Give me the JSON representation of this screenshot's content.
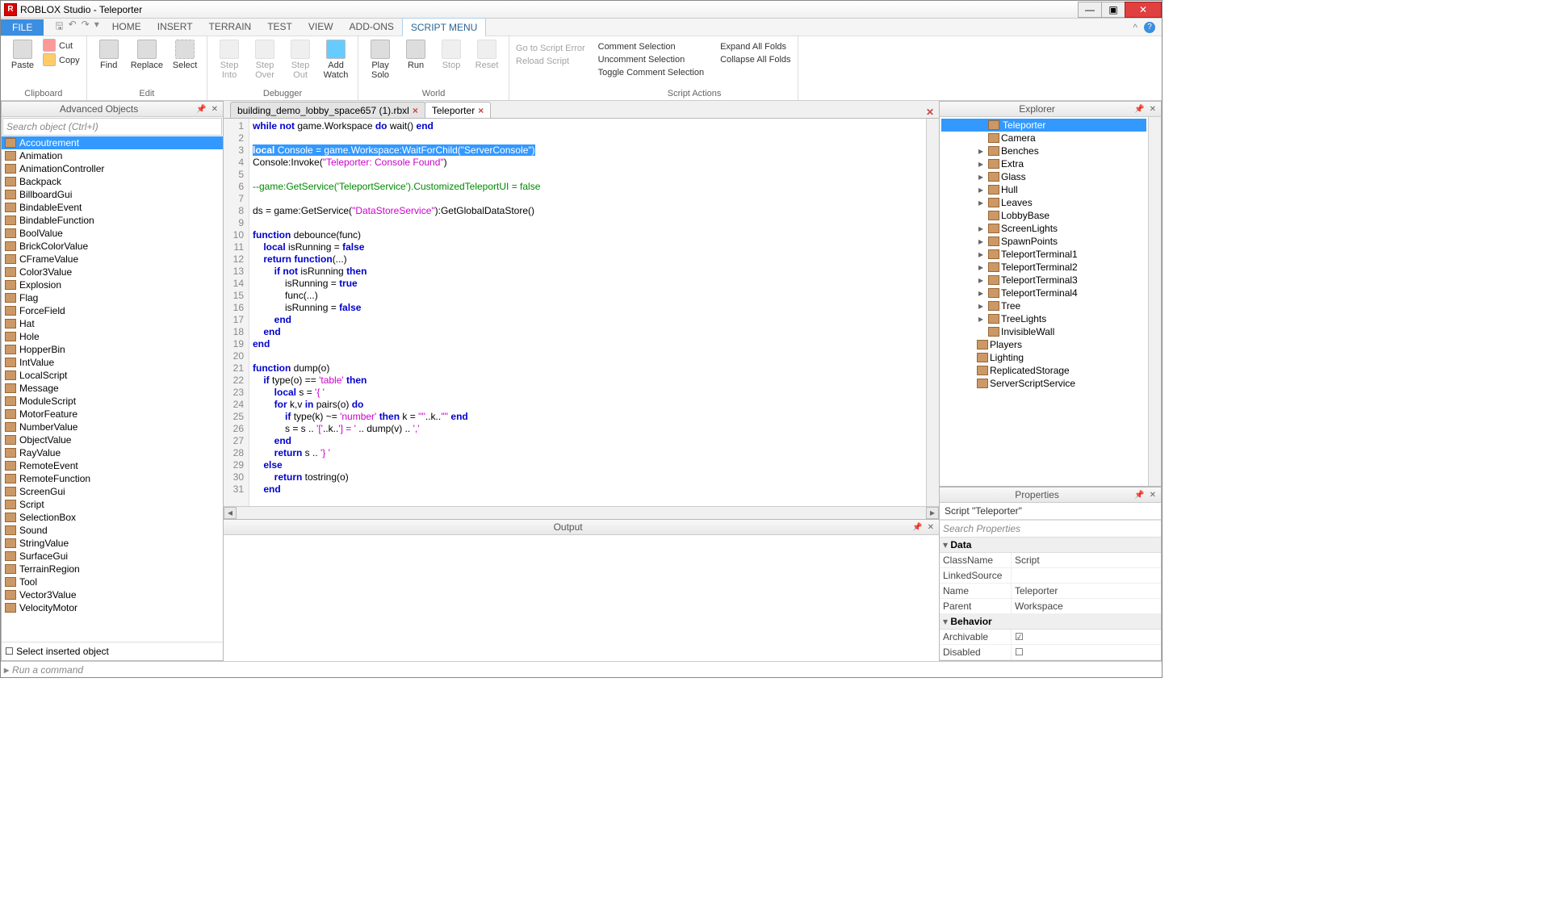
{
  "title": "ROBLOX Studio - Teleporter",
  "menu": {
    "file": "FILE",
    "tabs": [
      "HOME",
      "INSERT",
      "TERRAIN",
      "TEST",
      "VIEW",
      "ADD-ONS",
      "SCRIPT MENU"
    ],
    "activeTab": "SCRIPT MENU"
  },
  "ribbon": {
    "clipboard": {
      "paste": "Paste",
      "cut": "Cut",
      "copy": "Copy",
      "label": "Clipboard"
    },
    "edit": {
      "find": "Find",
      "replace": "Replace",
      "select": "Select",
      "label": "Edit"
    },
    "debugger": {
      "into": "Step\nInto",
      "over": "Step\nOver",
      "out": "Step\nOut",
      "watch": "Add\nWatch",
      "label": "Debugger"
    },
    "world": {
      "solo": "Play\nSolo",
      "run": "Run",
      "stop": "Stop",
      "reset": "Reset",
      "label": "World"
    },
    "scriptnav": {
      "goerr": "Go to Script Error",
      "reload": "Reload Script"
    },
    "scriptactions": {
      "c1": "Comment Selection",
      "c2": "Uncomment Selection",
      "c3": "Toggle Comment Selection",
      "c4": "Expand All Folds",
      "c5": "Collapse All Folds",
      "label": "Script Actions"
    }
  },
  "leftPanel": {
    "title": "Advanced Objects",
    "search": "Search object (Ctrl+I)",
    "items": [
      "Accoutrement",
      "Animation",
      "AnimationController",
      "Backpack",
      "BillboardGui",
      "BindableEvent",
      "BindableFunction",
      "BoolValue",
      "BrickColorValue",
      "CFrameValue",
      "Color3Value",
      "Explosion",
      "Flag",
      "ForceField",
      "Hat",
      "Hole",
      "HopperBin",
      "IntValue",
      "LocalScript",
      "Message",
      "ModuleScript",
      "MotorFeature",
      "NumberValue",
      "ObjectValue",
      "RayValue",
      "RemoteEvent",
      "RemoteFunction",
      "ScreenGui",
      "Script",
      "SelectionBox",
      "Sound",
      "StringValue",
      "SurfaceGui",
      "TerrainRegion",
      "Tool",
      "Vector3Value",
      "VelocityMotor"
    ],
    "selected": "Accoutrement",
    "checkbox": "Select inserted object"
  },
  "fileTabs": {
    "tabs": [
      "building_demo_lobby_space657 (1).rbxl",
      "Teleporter"
    ],
    "active": "Teleporter"
  },
  "explorer": {
    "title": "Explorer",
    "nodes": [
      {
        "d": 3,
        "label": "Teleporter",
        "sel": true,
        "icn": "script"
      },
      {
        "d": 3,
        "label": "Camera",
        "icn": "camera"
      },
      {
        "d": 3,
        "label": "Benches",
        "exp": "▸",
        "icn": "model"
      },
      {
        "d": 3,
        "label": "Extra",
        "exp": "▸",
        "icn": "model"
      },
      {
        "d": 3,
        "label": "Glass",
        "exp": "▸",
        "icn": "model"
      },
      {
        "d": 3,
        "label": "Hull",
        "exp": "▸",
        "icn": "model"
      },
      {
        "d": 3,
        "label": "Leaves",
        "exp": "▸",
        "icn": "model"
      },
      {
        "d": 3,
        "label": "LobbyBase",
        "icn": "model"
      },
      {
        "d": 3,
        "label": "ScreenLights",
        "exp": "▸",
        "icn": "model"
      },
      {
        "d": 3,
        "label": "SpawnPoints",
        "exp": "▸",
        "icn": "model"
      },
      {
        "d": 3,
        "label": "TeleportTerminal1",
        "exp": "▸",
        "icn": "model"
      },
      {
        "d": 3,
        "label": "TeleportTerminal2",
        "exp": "▸",
        "icn": "model"
      },
      {
        "d": 3,
        "label": "TeleportTerminal3",
        "exp": "▸",
        "icn": "model"
      },
      {
        "d": 3,
        "label": "TeleportTerminal4",
        "exp": "▸",
        "icn": "model"
      },
      {
        "d": 3,
        "label": "Tree",
        "exp": "▸",
        "icn": "model"
      },
      {
        "d": 3,
        "label": "TreeLights",
        "exp": "▸",
        "icn": "model"
      },
      {
        "d": 3,
        "label": "InvisibleWall",
        "icn": "part"
      },
      {
        "d": 2,
        "label": "Players",
        "icn": "players"
      },
      {
        "d": 2,
        "label": "Lighting",
        "icn": "lighting"
      },
      {
        "d": 2,
        "label": "ReplicatedStorage",
        "icn": "storage"
      },
      {
        "d": 2,
        "label": "ServerScriptService",
        "icn": "storage"
      }
    ]
  },
  "properties": {
    "title": "Properties",
    "subtitle": "Script \"Teleporter\"",
    "search": "Search Properties",
    "groups": [
      {
        "name": "Data",
        "rows": [
          [
            "ClassName",
            "Script"
          ],
          [
            "LinkedSource",
            ""
          ],
          [
            "Name",
            "Teleporter"
          ],
          [
            "Parent",
            "Workspace"
          ]
        ]
      },
      {
        "name": "Behavior",
        "rows": [
          [
            "Archivable",
            "☑"
          ],
          [
            "Disabled",
            "☐"
          ]
        ]
      }
    ]
  },
  "output": {
    "title": "Output"
  },
  "cmdbar": {
    "placeholder": "Run a command"
  },
  "code": {
    "lines": [
      {
        "n": 1,
        "html": "<span class='kw'>while</span> <span class='kw'>not</span> game.Workspace <span class='kw'>do</span> wait() <span class='kw'>end</span>"
      },
      {
        "n": 2,
        "html": ""
      },
      {
        "n": 3,
        "html": "<span class='sel'><span class='kw'>local</span> Console = game.Workspace:WaitForChild(<span class='str'>\"ServerConsole\"</span>)</span>"
      },
      {
        "n": 4,
        "html": "Console:Invoke(<span class='str'>\"Teleporter: Console Found\"</span>)"
      },
      {
        "n": 5,
        "html": ""
      },
      {
        "n": 6,
        "html": "<span class='cmt'>--game:GetService('TeleportService').CustomizedTeleportUI = false</span>"
      },
      {
        "n": 7,
        "html": ""
      },
      {
        "n": 8,
        "html": "ds = game:GetService(<span class='str'>\"DataStoreService\"</span>):GetGlobalDataStore()"
      },
      {
        "n": 9,
        "html": ""
      },
      {
        "n": 10,
        "html": "<span class='kw'>function</span> debounce(func)"
      },
      {
        "n": 11,
        "html": "    <span class='kw'>local</span> isRunning = <span class='kw'>false</span>"
      },
      {
        "n": 12,
        "html": "    <span class='kw'>return</span> <span class='kw'>function</span>(...)"
      },
      {
        "n": 13,
        "html": "        <span class='kw'>if</span> <span class='kw'>not</span> isRunning <span class='kw'>then</span>"
      },
      {
        "n": 14,
        "html": "            isRunning = <span class='kw'>true</span>"
      },
      {
        "n": 15,
        "html": "            func(...)"
      },
      {
        "n": 16,
        "html": "            isRunning = <span class='kw'>false</span>"
      },
      {
        "n": 17,
        "html": "        <span class='kw'>end</span>"
      },
      {
        "n": 18,
        "html": "    <span class='kw'>end</span>"
      },
      {
        "n": 19,
        "html": "<span class='kw'>end</span>"
      },
      {
        "n": 20,
        "html": ""
      },
      {
        "n": 21,
        "html": "<span class='kw'>function</span> dump(o)"
      },
      {
        "n": 22,
        "html": "    <span class='kw'>if</span> type(o) == <span class='str'>'table'</span> <span class='kw'>then</span>"
      },
      {
        "n": 23,
        "html": "        <span class='kw'>local</span> s = <span class='str'>'{ '</span>"
      },
      {
        "n": 24,
        "html": "        <span class='kw'>for</span> k,v <span class='kw'>in</span> pairs(o) <span class='kw'>do</span>"
      },
      {
        "n": 25,
        "html": "            <span class='kw'>if</span> type(k) ~= <span class='str'>'number'</span> <span class='kw'>then</span> k = <span class='str'>'\"'</span>..k..<span class='str'>'\"'</span> <span class='kw'>end</span>"
      },
      {
        "n": 26,
        "html": "            s = s .. <span class='str'>'['</span>..k..<span class='str'>'] = '</span> .. dump(v) .. <span class='str'>','</span>"
      },
      {
        "n": 27,
        "html": "        <span class='kw'>end</span>"
      },
      {
        "n": 28,
        "html": "        <span class='kw'>return</span> s .. <span class='str'>'} '</span>"
      },
      {
        "n": 29,
        "html": "    <span class='kw'>else</span>"
      },
      {
        "n": 30,
        "html": "        <span class='kw'>return</span> tostring(o)"
      },
      {
        "n": 31,
        "html": "    <span class='kw'>end</span>"
      }
    ]
  }
}
